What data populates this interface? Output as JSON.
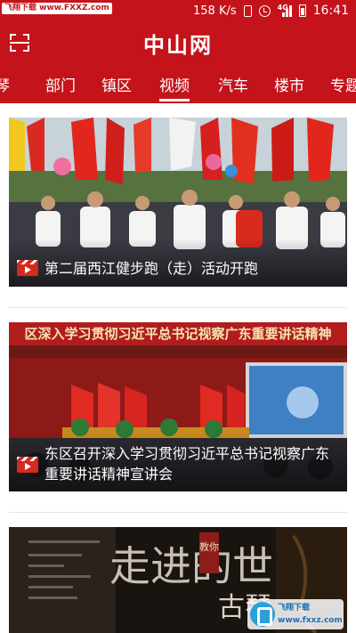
{
  "status_bar": {
    "watermark": "飞翔下载 www.FXXZ.com",
    "speed": "158 K/s",
    "network": "4G",
    "time": "16:41"
  },
  "header": {
    "logo": "中山网",
    "scan_icon": "scan-icon"
  },
  "tabs": [
    {
      "label": "琴",
      "active": false
    },
    {
      "label": "部门",
      "active": false
    },
    {
      "label": "镇区",
      "active": false
    },
    {
      "label": "视频",
      "active": true
    },
    {
      "label": "汽车",
      "active": false
    },
    {
      "label": "楼市",
      "active": false
    },
    {
      "label": "专题",
      "active": false
    }
  ],
  "videos": [
    {
      "title": "第二届西江健步跑（走）活动开跑",
      "badge_icon": "video-clapper-icon"
    },
    {
      "title": "东区召开深入学习贯彻习近平总书记视察广东重要讲话精神宣讲会",
      "banner": "区深入学习贯彻习近平总书记视察广东重要讲话精神",
      "badge_icon": "video-clapper-icon"
    },
    {
      "title": "",
      "poster_text_big": "走进的世",
      "poster_text_side": "古琴",
      "poster_seal": "教你"
    }
  ],
  "corner_watermark": {
    "text": "飞翔下载 www.fxxz.com"
  },
  "colors": {
    "brand_red": "#c5131b",
    "badge_red": "#d42a1f"
  }
}
